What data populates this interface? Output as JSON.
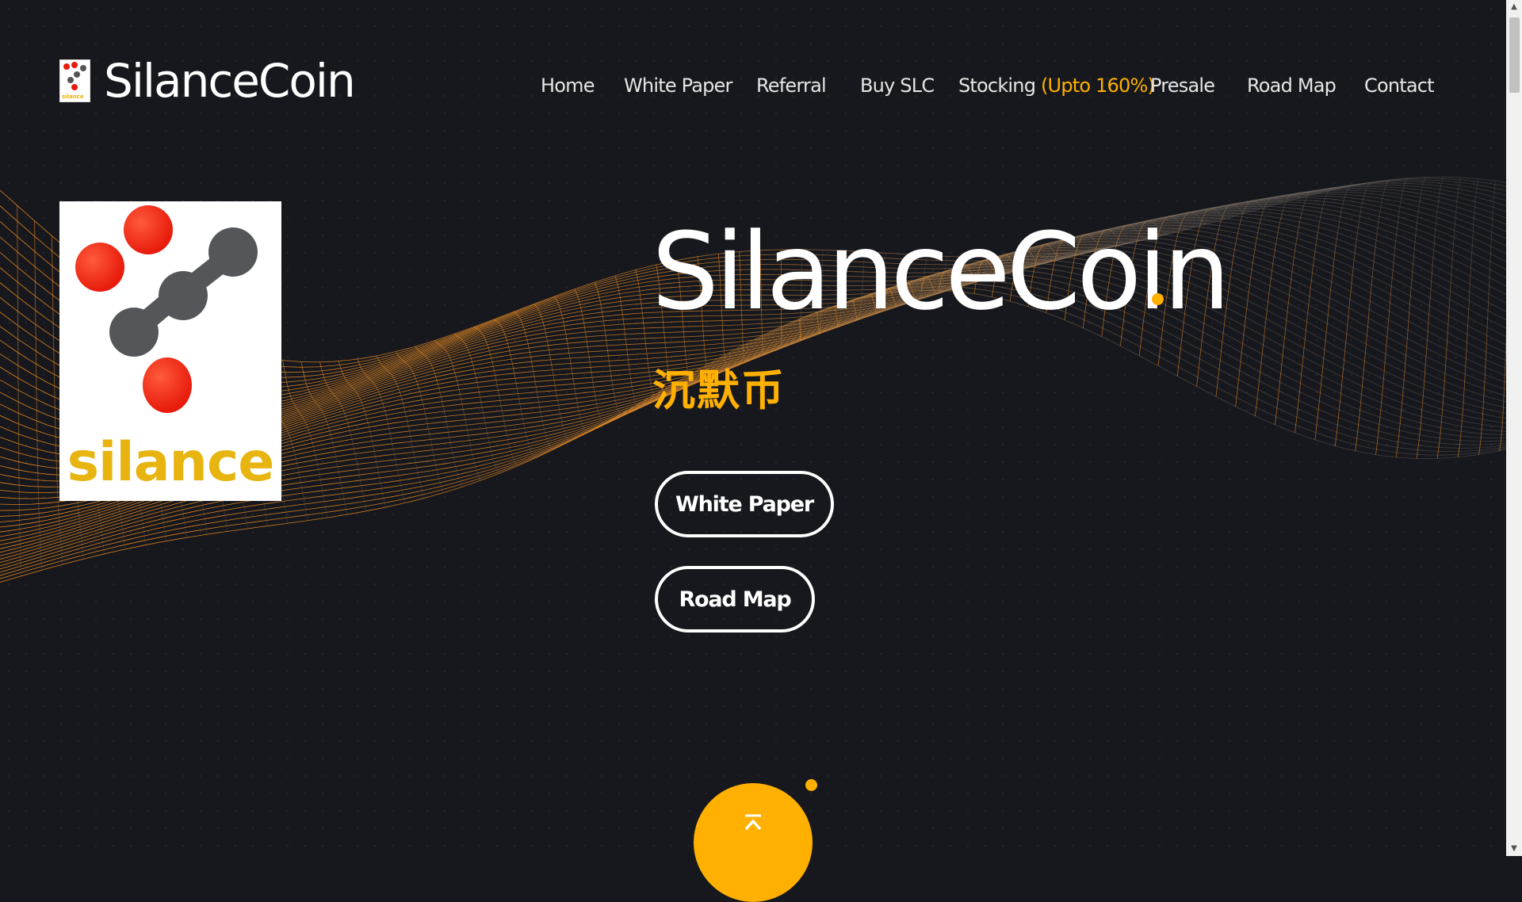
{
  "brand": {
    "name": "SilanceCoin",
    "logo_small_text": "silance"
  },
  "nav": {
    "items": [
      {
        "label": "Home"
      },
      {
        "label": "White Paper"
      },
      {
        "label": "Referral"
      },
      {
        "label": "Buy SLC"
      },
      {
        "label": "Stocking",
        "highlight": "(Upto 160%)"
      },
      {
        "label": "Presale"
      },
      {
        "label": "Road Map"
      },
      {
        "label": "Contact"
      }
    ]
  },
  "hero": {
    "logo_word": "silance",
    "title": "SilanceCoin",
    "subtitle": "沉默币",
    "buttons": {
      "white_paper": "White Paper",
      "road_map": "Road Map"
    }
  },
  "scroll_top": {
    "icon": "chevron-up-bar-icon"
  },
  "colors": {
    "accent": "#ffb000",
    "background": "#17181d",
    "logo_red": "#e81c0c",
    "logo_gray": "#555659",
    "logo_word": "#e8b410"
  }
}
